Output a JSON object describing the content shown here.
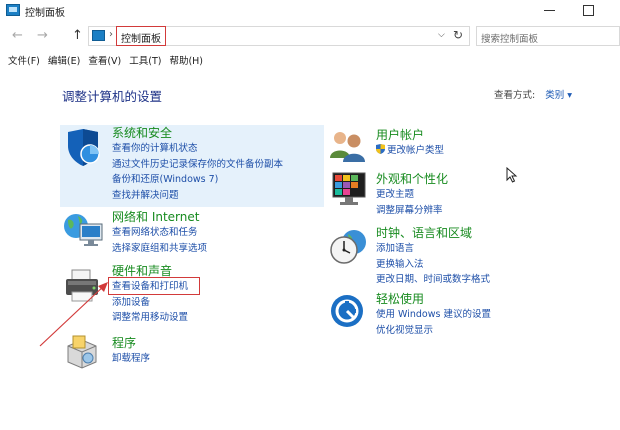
{
  "window": {
    "title": "控制面板"
  },
  "address": {
    "crumb": "控制面板",
    "search_placeholder": "搜索控制面板"
  },
  "nav": {
    "back": "←",
    "forward": "→",
    "up": "↑",
    "sep": "›",
    "dropdown": "⌵",
    "refresh": "↻"
  },
  "menu": [
    "文件(F)",
    "编辑(E)",
    "查看(V)",
    "工具(T)",
    "帮助(H)"
  ],
  "main": {
    "title": "调整计算机的设置",
    "viewby_label": "查看方式:",
    "viewby_value": "类别 ▾"
  },
  "categories": {
    "system": {
      "title": "系统和安全",
      "links": [
        "查看你的计算机状态",
        "通过文件历史记录保存你的文件备份副本",
        "备份和还原(Windows 7)",
        "查找并解决问题"
      ]
    },
    "network": {
      "title": "网络和 Internet",
      "links": [
        "查看网络状态和任务",
        "选择家庭组和共享选项"
      ]
    },
    "hardware": {
      "title": "硬件和声音",
      "links": [
        "查看设备和打印机",
        "添加设备",
        "调整常用移动设置"
      ]
    },
    "programs": {
      "title": "程序",
      "links": [
        "卸载程序"
      ]
    },
    "accounts": {
      "title": "用户帐户",
      "links": [
        "更改帐户类型"
      ]
    },
    "appearance": {
      "title": "外观和个性化",
      "links": [
        "更改主题",
        "调整屏幕分辨率"
      ]
    },
    "clock": {
      "title": "时钟、语言和区域",
      "links": [
        "添加语言",
        "更换输入法",
        "更改日期、时间或数字格式"
      ]
    },
    "ease": {
      "title": "轻松使用",
      "links": [
        "使用 Windows 建议的设置",
        "优化视觉显示"
      ]
    }
  },
  "colors": {
    "title_blue": "#1e3287",
    "category_green": "#178b1f",
    "link_blue": "#1e4fa8",
    "annotation_red": "#d23a3a",
    "highlight_bg": "#e5f1fb"
  }
}
